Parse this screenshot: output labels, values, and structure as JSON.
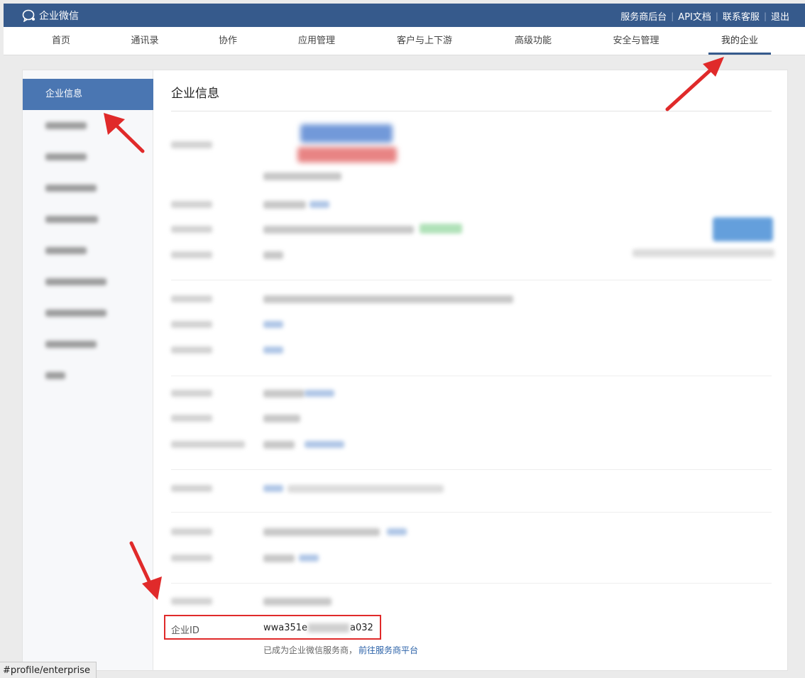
{
  "header": {
    "app_name": "企业微信",
    "links": [
      "服务商后台",
      "API文档",
      "联系客服",
      "退出"
    ]
  },
  "nav": {
    "items": [
      "首页",
      "通讯录",
      "协作",
      "应用管理",
      "客户与上下游",
      "高级功能",
      "安全与管理",
      "我的企业"
    ],
    "active": "我的企业"
  },
  "sidebar": {
    "active_label": "企业信息"
  },
  "main": {
    "title": "企业信息",
    "corp_id_label": "企业ID",
    "corp_id_prefix": "wwa351e",
    "corp_id_suffix": "a032",
    "provider_text": "已成为企业微信服务商，",
    "provider_link": "前往服务商平台"
  },
  "status_bar": {
    "url": "#profile/enterprise"
  },
  "colors": {
    "header_bg": "#365a8c",
    "active_side": "#4a76b2",
    "annotation_red": "#e02a2a"
  }
}
